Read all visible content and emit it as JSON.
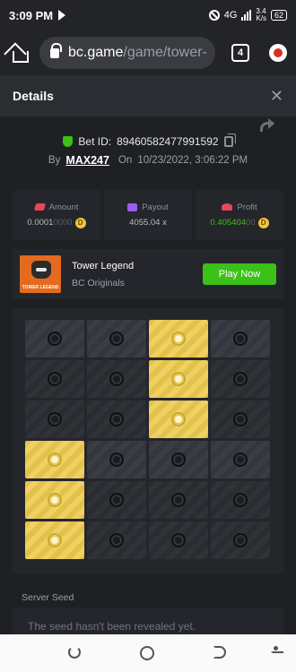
{
  "status_bar": {
    "time": "3:09 PM",
    "network": "4G",
    "speed": "3.4\nK/s",
    "battery": "62"
  },
  "browser": {
    "url_domain": "bc.game",
    "url_path": "/game/tower-",
    "tab_count": "4"
  },
  "details": {
    "title": "Details",
    "bet_id_label": "Bet ID:",
    "bet_id": "89460582477991592",
    "by_label": "By",
    "user": "MAX247",
    "on_label": "On",
    "date": "10/23/2022, 3:06:22 PM"
  },
  "stats": {
    "amount": {
      "label": "Amount",
      "value": "0.0001",
      "value_dim": "0000",
      "coin": "D"
    },
    "payout": {
      "label": "Payout",
      "value": "4055.04 x"
    },
    "profit": {
      "label": "Profit",
      "value": "0.405404",
      "value_dim": "00",
      "coin": "D"
    }
  },
  "game": {
    "thumb_label": "TOWER LEGEND",
    "title": "Tower Legend",
    "subtitle": "BC Originals",
    "play_label": "Play Now"
  },
  "board": {
    "columns": 4,
    "rows": [
      [
        "light",
        "light",
        "gold",
        "light"
      ],
      [
        "dark",
        "dark",
        "gold",
        "dark"
      ],
      [
        "dark",
        "dark",
        "gold",
        "dark"
      ],
      [
        "gold",
        "light",
        "light",
        "light"
      ],
      [
        "gold",
        "dark",
        "dark",
        "dark"
      ],
      [
        "gold",
        "dark",
        "dark",
        "dark"
      ]
    ]
  },
  "seed": {
    "label": "Server Seed",
    "placeholder": "The seed hasn't been revealed yet."
  },
  "colors": {
    "accent_green": "#3bc117",
    "gold": "#f0d063",
    "background": "#1e2024"
  }
}
